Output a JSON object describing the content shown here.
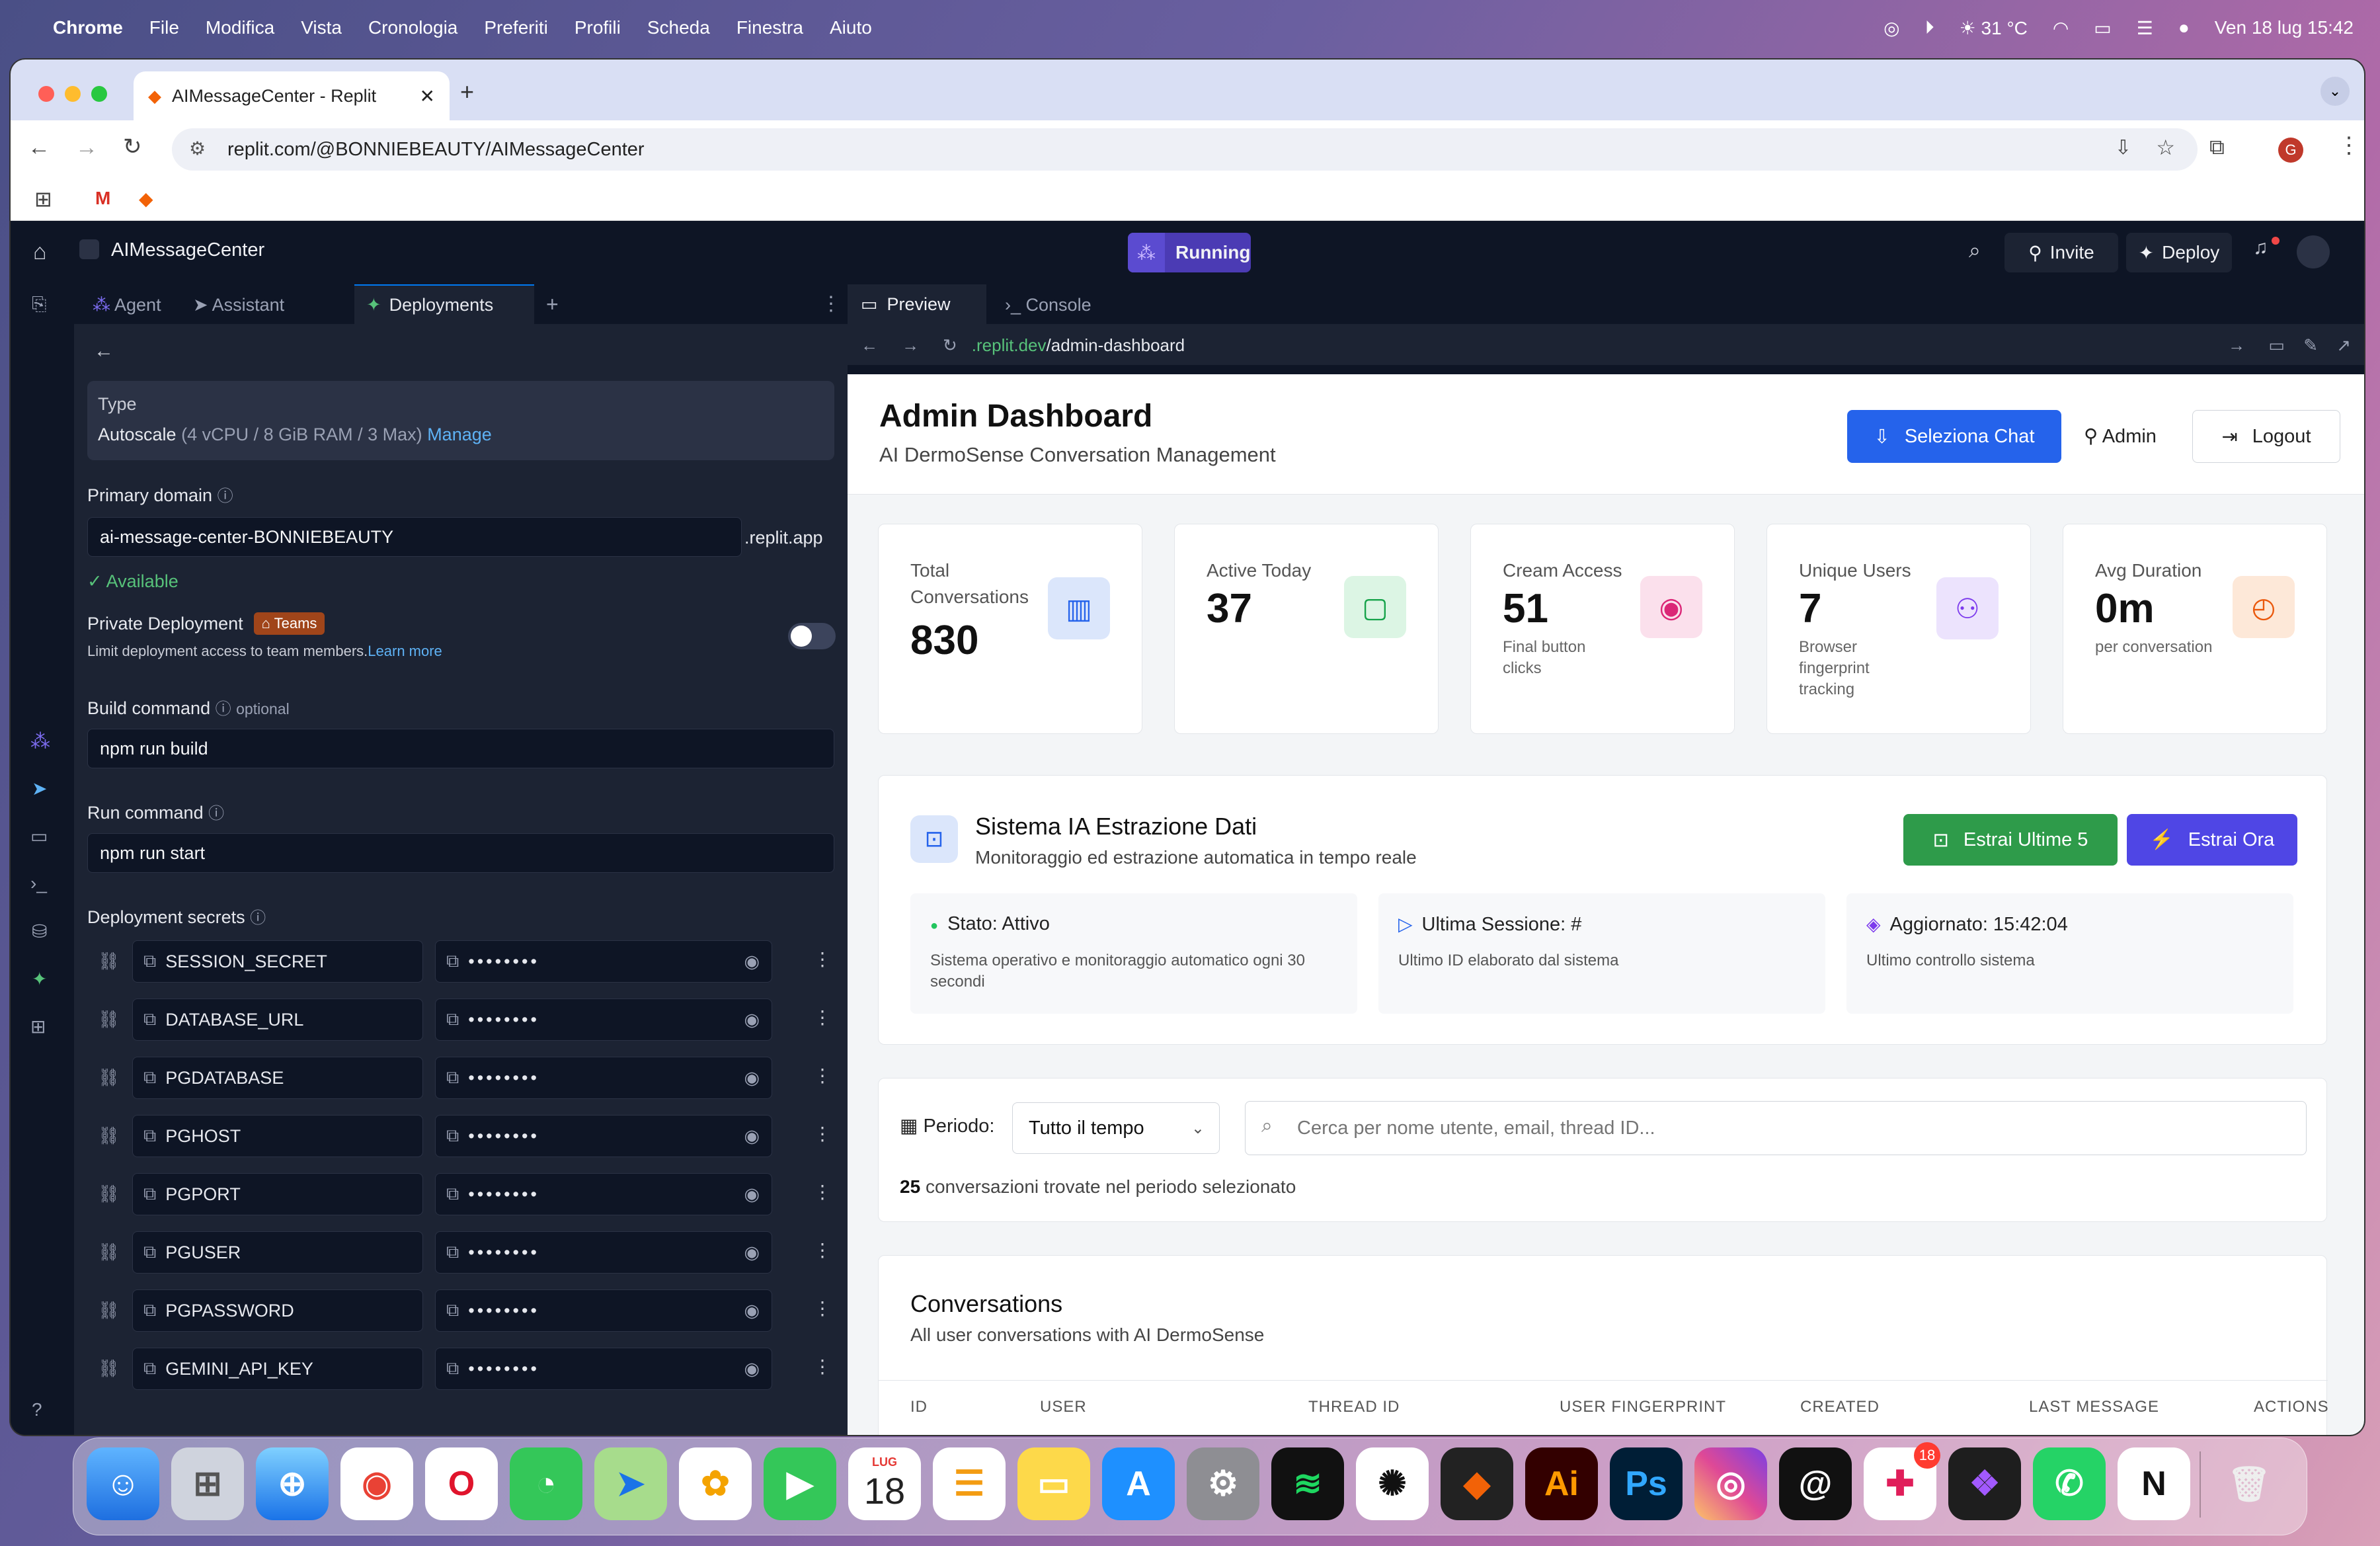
{
  "menubar": {
    "apple": "",
    "items": [
      "Chrome",
      "File",
      "Modifica",
      "Vista",
      "Cronologia",
      "Preferiti",
      "Profili",
      "Scheda",
      "Finestra",
      "Aiuto"
    ],
    "temp": "31 °C",
    "datetime": "Ven 18 lug  15:42"
  },
  "browser": {
    "tab_title": "AIMessageCenter - Replit",
    "url": "replit.com/@BONNIEBEAUTY/AIMessageCenter",
    "profile_initial": "G"
  },
  "replit": {
    "project_name": "AIMessageCenter",
    "status": "Running",
    "invite": "Invite",
    "deploy": "Deploy",
    "tabs": [
      "Agent",
      "Assistant",
      "Deployments"
    ],
    "preview_tabs": [
      "Preview",
      "Console"
    ],
    "preview_url_host": ".replit.dev",
    "preview_url_path": "/admin-dashboard"
  },
  "deploy_panel": {
    "type_label": "Type",
    "type_value": "Autoscale",
    "type_spec": "(4 vCPU / 8 GiB RAM / 3 Max)",
    "manage": "Manage",
    "primary_domain_label": "Primary domain",
    "domain_value": "ai-message-center-BONNIEBEAUTY",
    "domain_suffix": ".replit.app",
    "available": "Available",
    "private_label": "Private Deployment",
    "teams_badge": "Teams",
    "private_desc": "Limit deployment access to team members.",
    "learn_more": "Learn more",
    "build_label": "Build command",
    "optional": "optional",
    "build_value": "npm run build",
    "run_label": "Run command",
    "run_value": "npm run start",
    "secrets_label": "Deployment secrets",
    "secrets": [
      "SESSION_SECRET",
      "DATABASE_URL",
      "PGDATABASE",
      "PGHOST",
      "PGPORT",
      "PGUSER",
      "PGPASSWORD",
      "GEMINI_API_KEY"
    ],
    "masked": "••••••••"
  },
  "dashboard": {
    "title": "Admin Dashboard",
    "subtitle": "AI DermoSense Conversation Management",
    "select_chat": "Seleziona Chat",
    "admin": "Admin",
    "logout": "Logout",
    "stats": [
      {
        "label": "Total Conversations",
        "value": "830",
        "sub": "",
        "icon": "bar-chart-icon",
        "color": "#2563eb",
        "bg": "#dbe6fb"
      },
      {
        "label": "Active Today",
        "value": "37",
        "sub": "",
        "icon": "message-icon",
        "color": "#16a34a",
        "bg": "#dcf5e4"
      },
      {
        "label": "Cream Access",
        "value": "51",
        "sub": "Final button clicks",
        "icon": "eye-icon",
        "color": "#db2777",
        "bg": "#fbe0ec"
      },
      {
        "label": "Unique Users",
        "value": "7",
        "sub": "Browser fingerprint tracking",
        "icon": "users-icon",
        "color": "#7c3aed",
        "bg": "#ece3fd"
      },
      {
        "label": "Avg Duration",
        "value": "0m",
        "sub": "per conversation",
        "icon": "clock-icon",
        "color": "#ea580c",
        "bg": "#fde8d8"
      }
    ],
    "ai_title": "Sistema IA Estrazione Dati",
    "ai_subtitle": "Monitoraggio ed estrazione automatica in tempo reale",
    "extract_last5": "Estrai Ultime 5",
    "extract_now": "Estrai Ora",
    "status_boxes": [
      {
        "title": "Stato: Attivo",
        "desc": "Sistema operativo e monitoraggio automatico ogni 30 secondi"
      },
      {
        "title": "Ultima Sessione: #",
        "desc": "Ultimo ID elaborato dal sistema"
      },
      {
        "title": "Aggiornato: 15:42:04",
        "desc": "Ultimo controllo sistema"
      }
    ],
    "period_label": "Periodo:",
    "period_value": "Tutto il tempo",
    "search_placeholder": "Cerca per nome utente, email, thread ID...",
    "found_count": "25",
    "found_text": "conversazioni trovate nel periodo selezionato",
    "conv_title": "Conversations",
    "conv_subtitle": "All user conversations with AI DermoSense",
    "columns": [
      "ID",
      "USER",
      "THREAD ID",
      "USER FINGERPRINT",
      "CREATED",
      "LAST MESSAGE",
      "ACTIONS"
    ]
  },
  "dock": {
    "calendar_month": "LUG",
    "calendar_day": "18",
    "slack_badge": "18",
    "ai_label": "Ai",
    "ps_label": "Ps"
  }
}
